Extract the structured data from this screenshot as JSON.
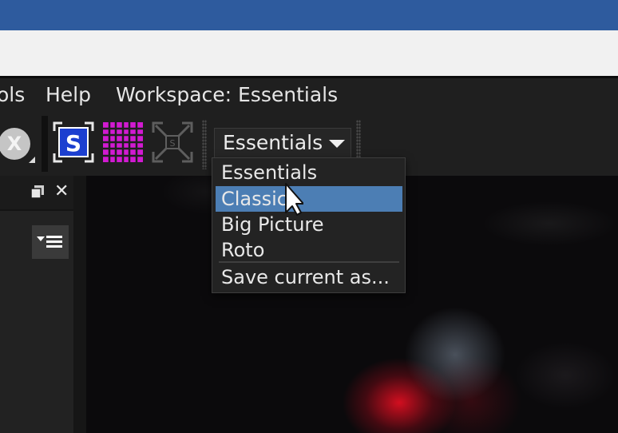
{
  "menu": {
    "items": [
      {
        "label": "ols"
      },
      {
        "label": "Help"
      },
      {
        "label": "Workspace: Essentials"
      }
    ]
  },
  "toolbar": {
    "x_button_label": "X",
    "workspace_select": {
      "value": "Essentials"
    },
    "icons": [
      "x-circle-icon",
      "s-square-icon",
      "grid-icon",
      "fit-frame-icon"
    ]
  },
  "workspace_menu": {
    "options": [
      {
        "label": "Essentials",
        "selected": false
      },
      {
        "label": "Classic",
        "selected": true
      },
      {
        "label": "Big Picture",
        "selected": false
      },
      {
        "label": "Roto",
        "selected": false
      }
    ],
    "save_label": "Save current as..."
  },
  "panel": {
    "close_label": "✕"
  },
  "colors": {
    "title_bar": "#2e5b9e",
    "selection": "#4c7eb4",
    "grid_icon": "#d21ad2",
    "s_icon": "#1c3fd0"
  }
}
